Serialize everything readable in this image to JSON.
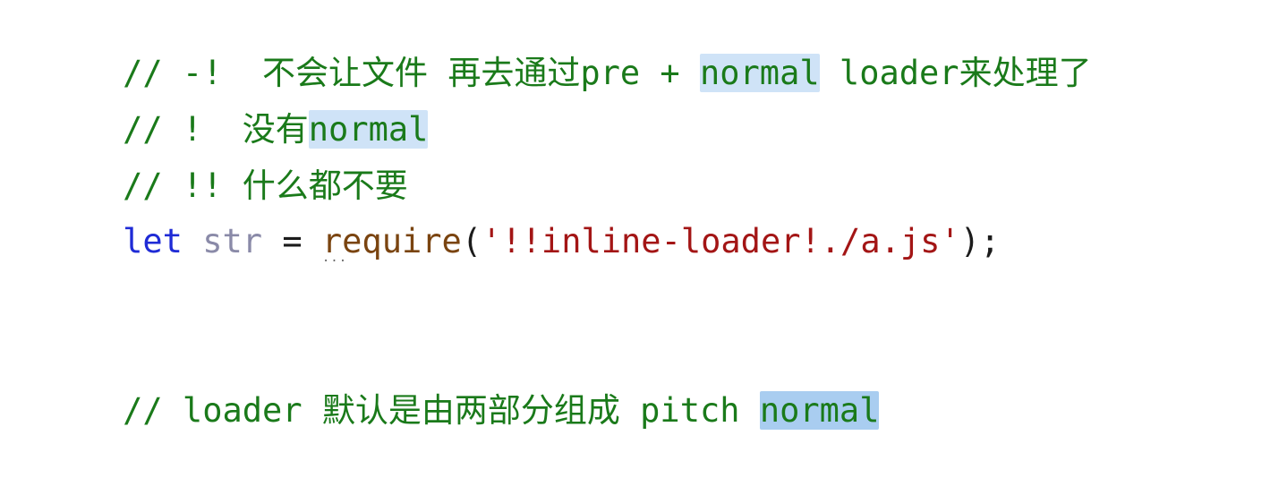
{
  "editor": {
    "lines": [
      {
        "comment_prefix": "// -!  不会让文件 再去通过pre + ",
        "highlight": "normal",
        "comment_suffix": " loader来处理了"
      },
      {
        "comment_prefix": "// !  没有",
        "highlight": "normal"
      },
      {
        "comment": "// !! 什么都不要"
      },
      {
        "keyword": "let",
        "variable": "str",
        "operator": " = ",
        "fn_name": "require",
        "open_paren": "(",
        "string": "'!!inline-loader!./a.js'",
        "close": ");",
        "hint_dots": "···"
      },
      {
        "comment_prefix": "// loader 默认是由两部分组成 pitch ",
        "highlight": "normal"
      }
    ]
  },
  "colors": {
    "comment": "#1a7a1a",
    "keyword": "#1f2bd6",
    "variable": "#8a8aa8",
    "function": "#7a4410",
    "string": "#a31515",
    "highlight": "#cfe3f7",
    "highlight_strong": "#a9cdf0"
  }
}
